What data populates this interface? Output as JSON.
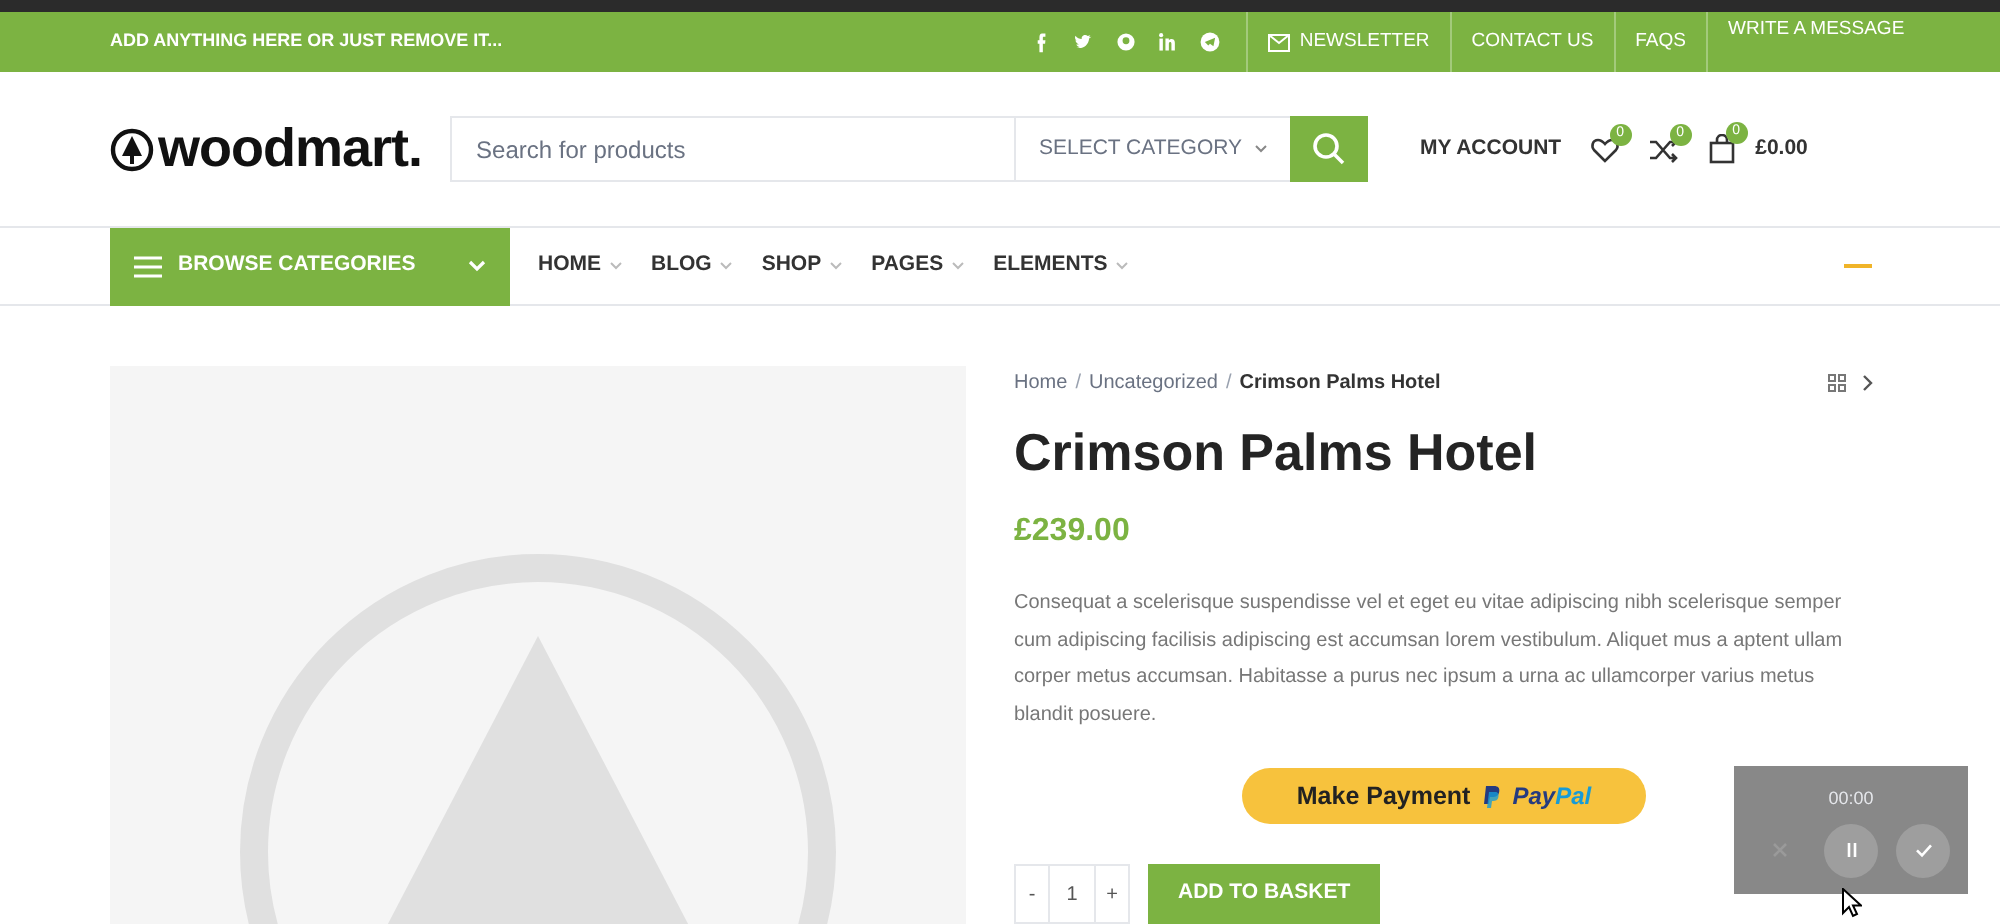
{
  "top_bar": {
    "promo": "ADD ANYTHING HERE OR JUST REMOVE IT...",
    "social": [
      {
        "kind": "facebook"
      },
      {
        "kind": "twitter"
      },
      {
        "kind": "pinterest"
      },
      {
        "kind": "linkedin"
      },
      {
        "kind": "telegram"
      }
    ],
    "links": [
      {
        "label": "NEWSLETTER",
        "kind": "mail"
      },
      {
        "label": "CONTACT US",
        "kind": "plain"
      },
      {
        "label": "FAQS",
        "kind": "plain"
      },
      {
        "label": "WRITE A MESSAGE",
        "kind": "raised"
      }
    ]
  },
  "header": {
    "logo": "woodmart.",
    "search": {
      "placeholder": "Search for products",
      "category": "SELECT CATEGORY"
    },
    "account": "MY ACCOUNT",
    "wishlist_count": "0",
    "compare_count": "0",
    "cart_count": "0",
    "cart_total": "£0.00"
  },
  "nav": {
    "browse": "BROWSE CATEGORIES",
    "items": [
      "HOME",
      "BLOG",
      "SHOP",
      "PAGES",
      "ELEMENTS"
    ]
  },
  "product": {
    "breadcrumb": [
      "Home",
      "Uncategorized",
      "Crimson Palms Hotel"
    ],
    "breadcrumb_separator": "/",
    "title": "Crimson Palms Hotel",
    "price": "£239.00",
    "description": "Consequat a scelerisque suspendisse vel et eget eu vitae adipiscing nibh scelerisque semper cum adipiscing facilisis adipiscing est accumsan lorem vestibulum. Aliquet mus a aptent ullam corper metus accumsan. Habitasse a purus nec ipsum a urna ac ullamcorper varius metus blandit posuere.",
    "payment": {
      "label": "Make Payment",
      "brand_a": "Pay",
      "brand_b": "Pal"
    },
    "quantity": {
      "minus": "-",
      "value": "1",
      "plus": "+"
    },
    "add_to_basket": "ADD TO BASKET"
  },
  "recorder": {
    "time": "00:00",
    "buttons": [
      {
        "kind": "cancel",
        "disabled": true
      },
      {
        "kind": "pause",
        "disabled": false
      },
      {
        "kind": "done",
        "disabled": false
      }
    ]
  }
}
